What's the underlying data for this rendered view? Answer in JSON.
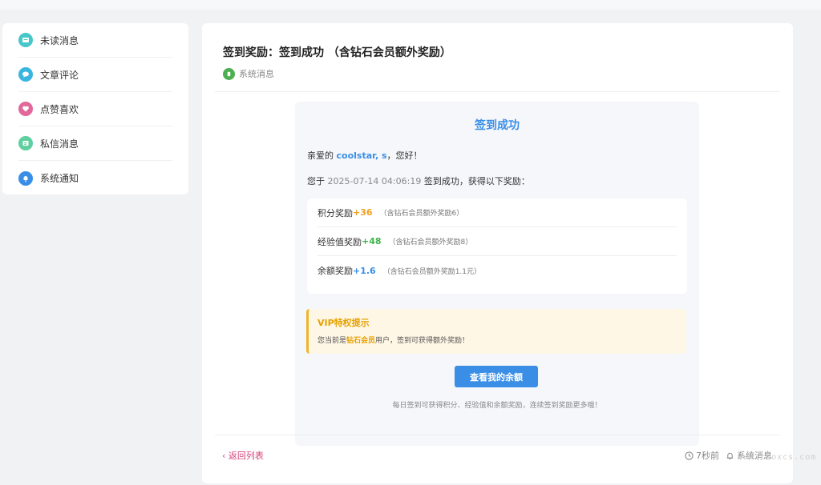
{
  "sidebar": {
    "items": [
      {
        "label": "未读消息",
        "icon": "unread-message-icon",
        "color": "#47c7c9"
      },
      {
        "label": "文章评论",
        "icon": "comment-icon",
        "color": "#38b6e0"
      },
      {
        "label": "点赞喜欢",
        "icon": "heart-icon",
        "color": "#e2679a"
      },
      {
        "label": "私信消息",
        "icon": "private-message-icon",
        "color": "#5fcfa0"
      },
      {
        "label": "系统通知",
        "icon": "bell-icon",
        "color": "#3a8ee6"
      }
    ]
  },
  "message": {
    "title": "签到奖励：签到成功 （含钻石会员额外奖励）",
    "category": "系统消息"
  },
  "mail": {
    "heading": "签到成功",
    "greeting_prefix": "亲爱的 ",
    "username": "coolstar, s",
    "greeting_suffix": "，您好！",
    "line_prefix": "您于 ",
    "date": "2025-07-14 04:06:19",
    "line_suffix": " 签到成功，获得以下奖励：",
    "rewards": [
      {
        "label": "积分奖励",
        "value": "+36",
        "note": "（含钻石会员额外奖励6）",
        "color": "#f0a020"
      },
      {
        "label": "经验值奖励",
        "value": "+48",
        "note": "（含钻石会员额外奖励8）",
        "color": "#3db34a"
      },
      {
        "label": "余额奖励",
        "value": "+1.6",
        "note": "（含钻石会员额外奖励1.1元）",
        "color": "#3a8ee6"
      }
    ],
    "vip_title": "VIP特权提示",
    "vip_prefix": "您当前是",
    "vip_level": "钻石会员",
    "vip_suffix": "用户，签到可获得额外奖励！",
    "button": "查看我的余额",
    "footer": "每日签到可获得积分、经验值和余额奖励，连续签到奖励更多哦！"
  },
  "footer": {
    "back": "‹ 返回列表",
    "time": "7秒前",
    "type": "系统消息"
  },
  "watermark": "www.rooxcs.com"
}
